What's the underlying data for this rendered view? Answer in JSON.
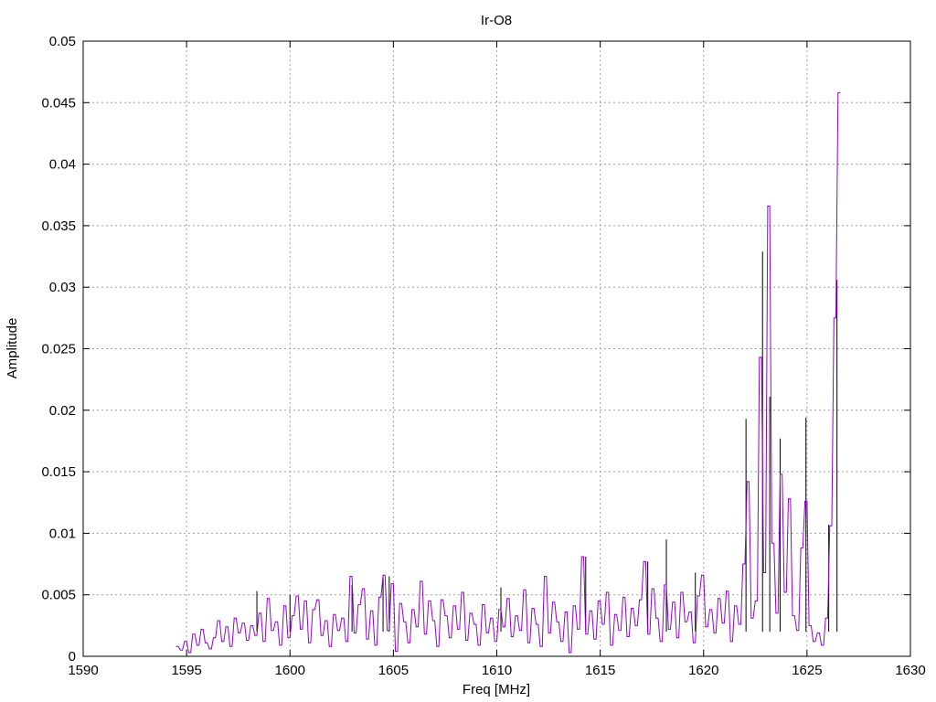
{
  "chart_data": {
    "type": "line",
    "title": "Ir-O8",
    "xlabel": "Freq [MHz]",
    "ylabel": "Amplitude",
    "xlim": [
      1590,
      1630
    ],
    "ylim": [
      0,
      0.05
    ],
    "grid": true,
    "xticks": [
      "1590",
      "1595",
      "1600",
      "1605",
      "1610",
      "1615",
      "1620",
      "1625",
      "1630"
    ],
    "yticks": [
      "0",
      "0.005",
      "0.01",
      "0.015",
      "0.02",
      "0.025",
      "0.03",
      "0.035",
      "0.04",
      "0.045",
      "0.05"
    ],
    "series": [
      {
        "name": "black",
        "color": "#000000",
        "baseline": 0.002,
        "x": [
          1598.4,
          1600,
          1603,
          1604.5,
          1604.8,
          1610.2,
          1614.3,
          1617.3,
          1618.2,
          1619.6,
          1622.05,
          1622.85,
          1623.2,
          1623.7,
          1624.95,
          1626.05,
          1626.45
        ],
        "y": [
          0.0053,
          0.005,
          0.0058,
          0.0066,
          0.0065,
          0.0056,
          0.0081,
          0.0077,
          0.0095,
          0.0068,
          0.0193,
          0.0329,
          0.0211,
          0.0177,
          0.0194,
          0.0107,
          0.0306
        ]
      },
      {
        "name": "purple",
        "color": "#9400d3",
        "x_start": 1594.5,
        "x_step": 0.2,
        "y": [
          0.0008,
          0.0005,
          0.0012,
          0.0003,
          0.0018,
          0.0009,
          0.0022,
          0.0011,
          0.0006,
          0.0015,
          0.0029,
          0.0012,
          0.0024,
          0.0008,
          0.0031,
          0.0019,
          0.0027,
          0.0013,
          0.0025,
          0.0017,
          0.0035,
          0.0012,
          0.0047,
          0.0021,
          0.0028,
          0.0009,
          0.0041,
          0.0015,
          0.0033,
          0.0049,
          0.0022,
          0.0045,
          0.0011,
          0.0038,
          0.0046,
          0.0017,
          0.0029,
          0.0008,
          0.0034,
          0.0021,
          0.0031,
          0.0012,
          0.0065,
          0.0019,
          0.0042,
          0.0055,
          0.0014,
          0.0037,
          0.0009,
          0.0048,
          0.0066,
          0.0021,
          0.0059,
          0.0004,
          0.0043,
          0.0028,
          0.0011,
          0.0038,
          0.0024,
          0.0061,
          0.0018,
          0.0045,
          0.0029,
          0.0008,
          0.0046,
          0.0033,
          0.0015,
          0.0041,
          0.0022,
          0.0052,
          0.0013,
          0.0035,
          0.0026,
          0.0009,
          0.0042,
          0.0019,
          0.0031,
          0.0012,
          0.0038,
          0.0024,
          0.0047,
          0.0016,
          0.0033,
          0.0021,
          0.0054,
          0.0011,
          0.0039,
          0.0026,
          0.0008,
          0.0065,
          0.0019,
          0.0044,
          0.0028,
          0.0012,
          0.0036,
          0.0003,
          0.0041,
          0.0022,
          0.0081,
          0.0018,
          0.0037,
          0.0014,
          0.0045,
          0.0026,
          0.0052,
          0.0009,
          0.0034,
          0.0021,
          0.0048,
          0.0016,
          0.0039,
          0.0025,
          0.0046,
          0.0077,
          0.0018,
          0.0055,
          0.0031,
          0.0012,
          0.0058,
          0.0022,
          0.0044,
          0.0015,
          0.0052,
          0.0028,
          0.0036,
          0.0011,
          0.0049,
          0.0066,
          0.0024,
          0.0038,
          0.0019,
          0.0047,
          0.0027,
          0.0053,
          0.0012,
          0.0041,
          0.0026,
          0.0075,
          0.0142,
          0.0031,
          0.0045,
          0.0243,
          0.0068,
          0.0366,
          0.0092,
          0.0035,
          0.0148,
          0.0052,
          0.0128,
          0.0033,
          0.0021,
          0.0088,
          0.0126,
          0.0025,
          0.0012,
          0.0019,
          0.0009,
          0.0031,
          0.0106,
          0.0275,
          0.0458
        ]
      }
    ]
  }
}
